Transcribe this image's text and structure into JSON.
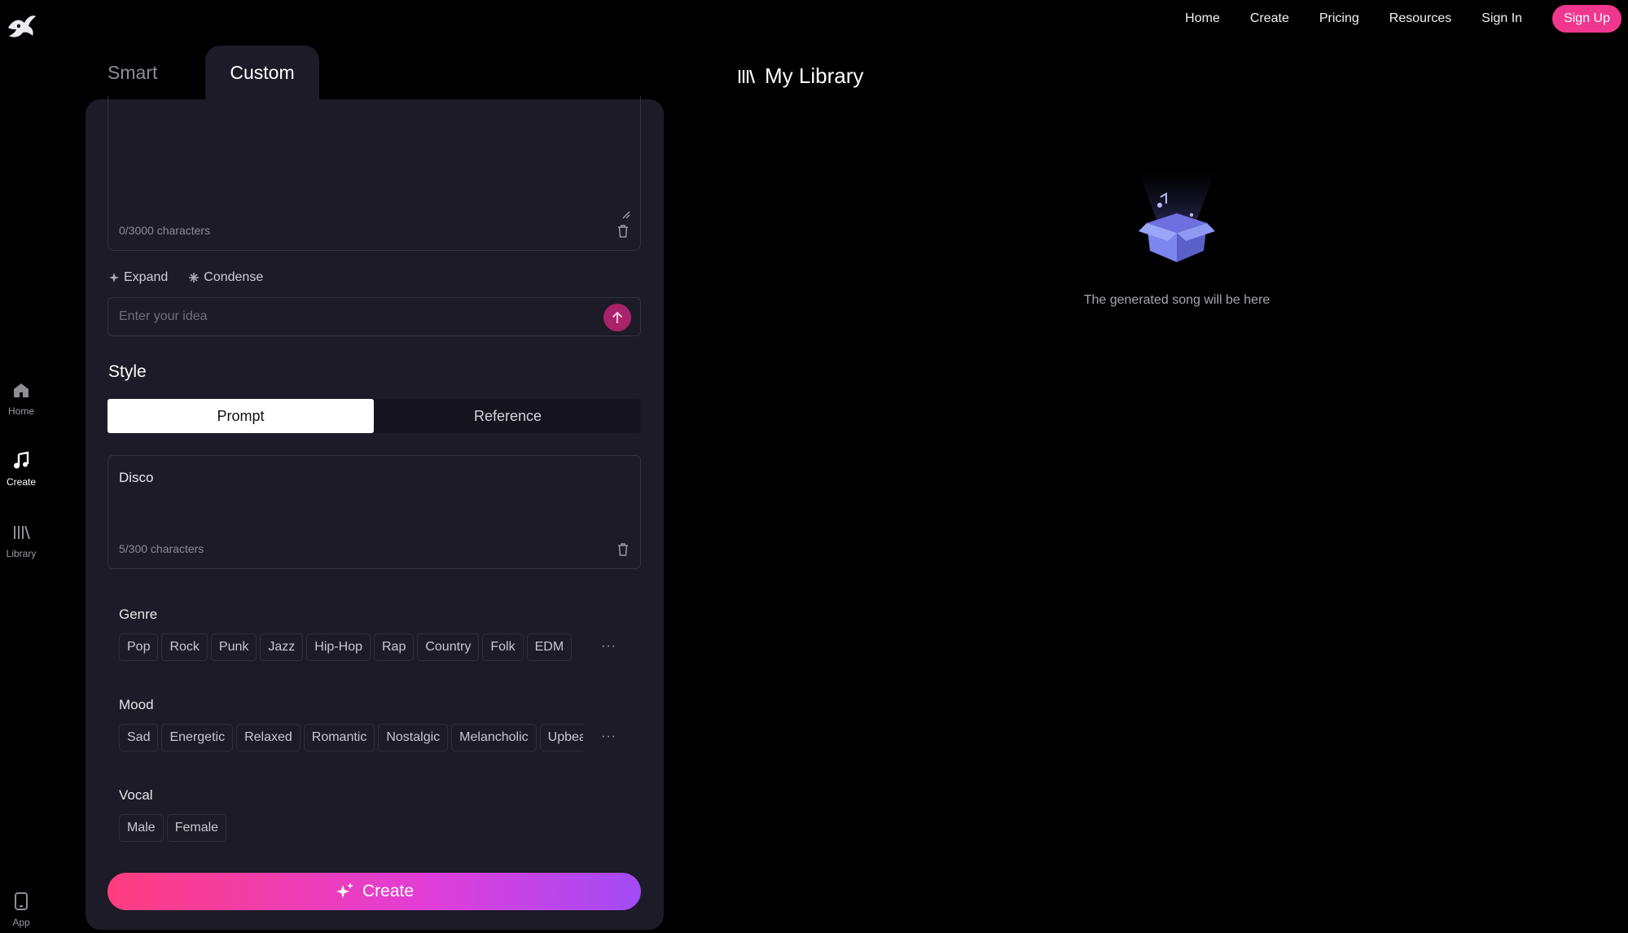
{
  "rail": {
    "items": [
      {
        "label": "Home",
        "icon": "home-icon",
        "active": false
      },
      {
        "label": "Create",
        "icon": "music-note-icon",
        "active": true
      },
      {
        "label": "Library",
        "icon": "library-icon",
        "active": false
      }
    ],
    "app_label": "App"
  },
  "nav": {
    "links": [
      "Home",
      "Create",
      "Pricing",
      "Resources",
      "Sign In"
    ],
    "signup": "Sign Up"
  },
  "tabs": {
    "smart": "Smart",
    "custom": "Custom",
    "active": "custom"
  },
  "lyrics": {
    "count": "0/3000 characters"
  },
  "tools": {
    "expand": "Expand",
    "condense": "Condense"
  },
  "idea": {
    "placeholder": "Enter your idea"
  },
  "style": {
    "title": "Style",
    "segments": {
      "prompt": "Prompt",
      "reference": "Reference",
      "active": "prompt"
    },
    "value": "Disco",
    "count": "5/300 characters"
  },
  "genre": {
    "label": "Genre",
    "chips": [
      "Pop",
      "Rock",
      "Punk",
      "Jazz",
      "Hip-Hop",
      "Rap",
      "Country",
      "Folk",
      "EDM"
    ]
  },
  "mood": {
    "label": "Mood",
    "chips": [
      "Sad",
      "Energetic",
      "Relaxed",
      "Romantic",
      "Nostalgic",
      "Melancholic",
      "Upbeat"
    ]
  },
  "vocal": {
    "label": "Vocal",
    "chips": [
      "Male",
      "Female"
    ]
  },
  "more_label": "···",
  "create_label": "Create",
  "library": {
    "title": "My Library",
    "empty": "The generated song will be here"
  },
  "colors": {
    "accent": "#f0378f",
    "panel": "#1c1b27",
    "background": "#000000"
  }
}
